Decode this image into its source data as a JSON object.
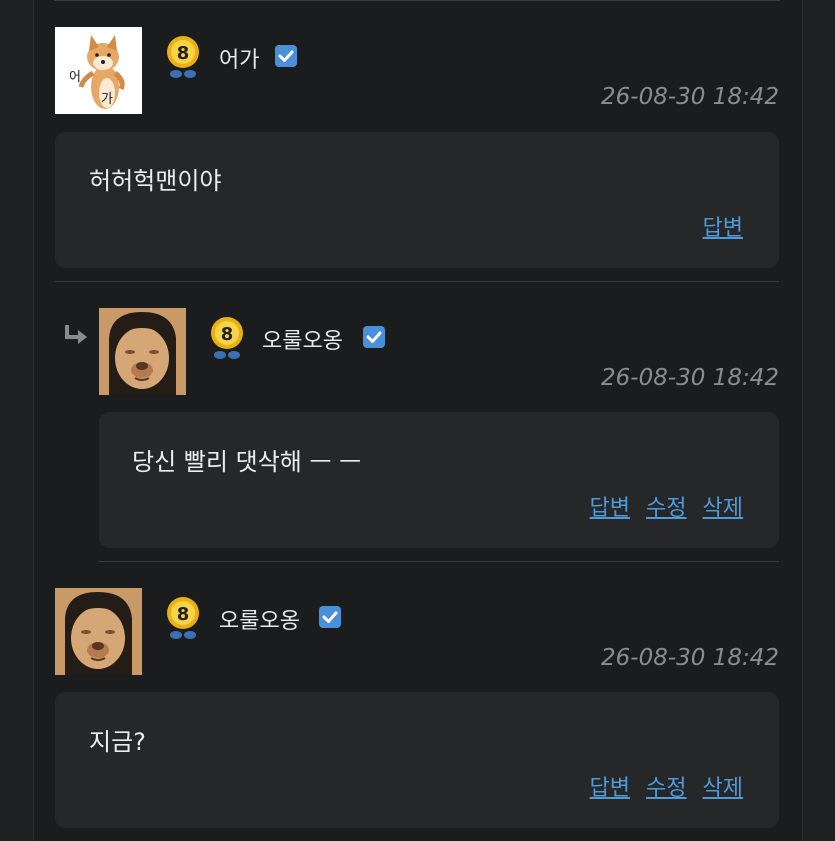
{
  "comments": [
    {
      "avatar": "shiba-dog-sticker",
      "avatar_text_1": "어",
      "avatar_text_2": "가",
      "level": "8",
      "nickname": "어가",
      "verified": true,
      "date": "26-08-30 18:42",
      "text": "허허헉맨이야",
      "actions": [
        "답변"
      ],
      "is_reply": false
    },
    {
      "avatar": "face-meme",
      "level": "8",
      "nickname": "오룰오옹",
      "verified": true,
      "date": "26-08-30 18:42",
      "text": "당신 빨리 댓삭해 ㅡ ㅡ",
      "actions": [
        "답변",
        "수정",
        "삭제"
      ],
      "is_reply": true
    },
    {
      "avatar": "face-meme",
      "level": "8",
      "nickname": "오룰오옹",
      "verified": true,
      "date": "26-08-30 18:42",
      "text": "지금?",
      "actions": [
        "답변",
        "수정",
        "삭제"
      ],
      "is_reply": false
    }
  ],
  "colors": {
    "background": "#1b1c1d",
    "bubble": "#262728",
    "link": "#4e9ad8",
    "verified": "#4a90d9",
    "date": "#8c8c8c"
  }
}
